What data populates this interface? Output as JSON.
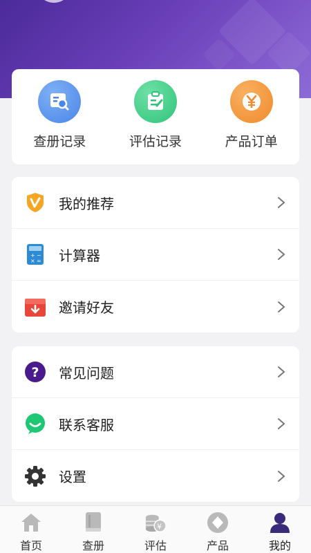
{
  "quick_actions": [
    {
      "label": "查册记录",
      "icon": "search-document-icon",
      "color": "#4a86e8"
    },
    {
      "label": "评估记录",
      "icon": "clipboard-edit-icon",
      "color": "#2fc47a"
    },
    {
      "label": "产品订单",
      "icon": "yen-icon",
      "color": "#f08a2c"
    }
  ],
  "menu_group_1": [
    {
      "label": "我的推荐",
      "icon": "shield-v-icon",
      "color": "#f5a623"
    },
    {
      "label": "计算器",
      "icon": "calculator-icon",
      "color": "#2d8bd6"
    },
    {
      "label": "邀请好友",
      "icon": "gift-icon",
      "color": "#e8463a"
    }
  ],
  "menu_group_2": [
    {
      "label": "常见问题",
      "icon": "question-icon",
      "color": "#4a1a8c"
    },
    {
      "label": "联系客服",
      "icon": "chat-bubble-icon",
      "color": "#1ec773"
    },
    {
      "label": "设置",
      "icon": "gear-icon",
      "color": "#333333"
    }
  ],
  "tabs": [
    {
      "label": "首页",
      "icon": "home-icon"
    },
    {
      "label": "查册",
      "icon": "book-icon"
    },
    {
      "label": "评估",
      "icon": "coins-icon"
    },
    {
      "label": "产品",
      "icon": "diamond-icon"
    },
    {
      "label": "我的",
      "icon": "user-icon",
      "active": true
    }
  ],
  "colors": {
    "hero_start": "#4b2a9a",
    "hero_end": "#8d6bd6",
    "active_tab": "#3a2a7a"
  }
}
